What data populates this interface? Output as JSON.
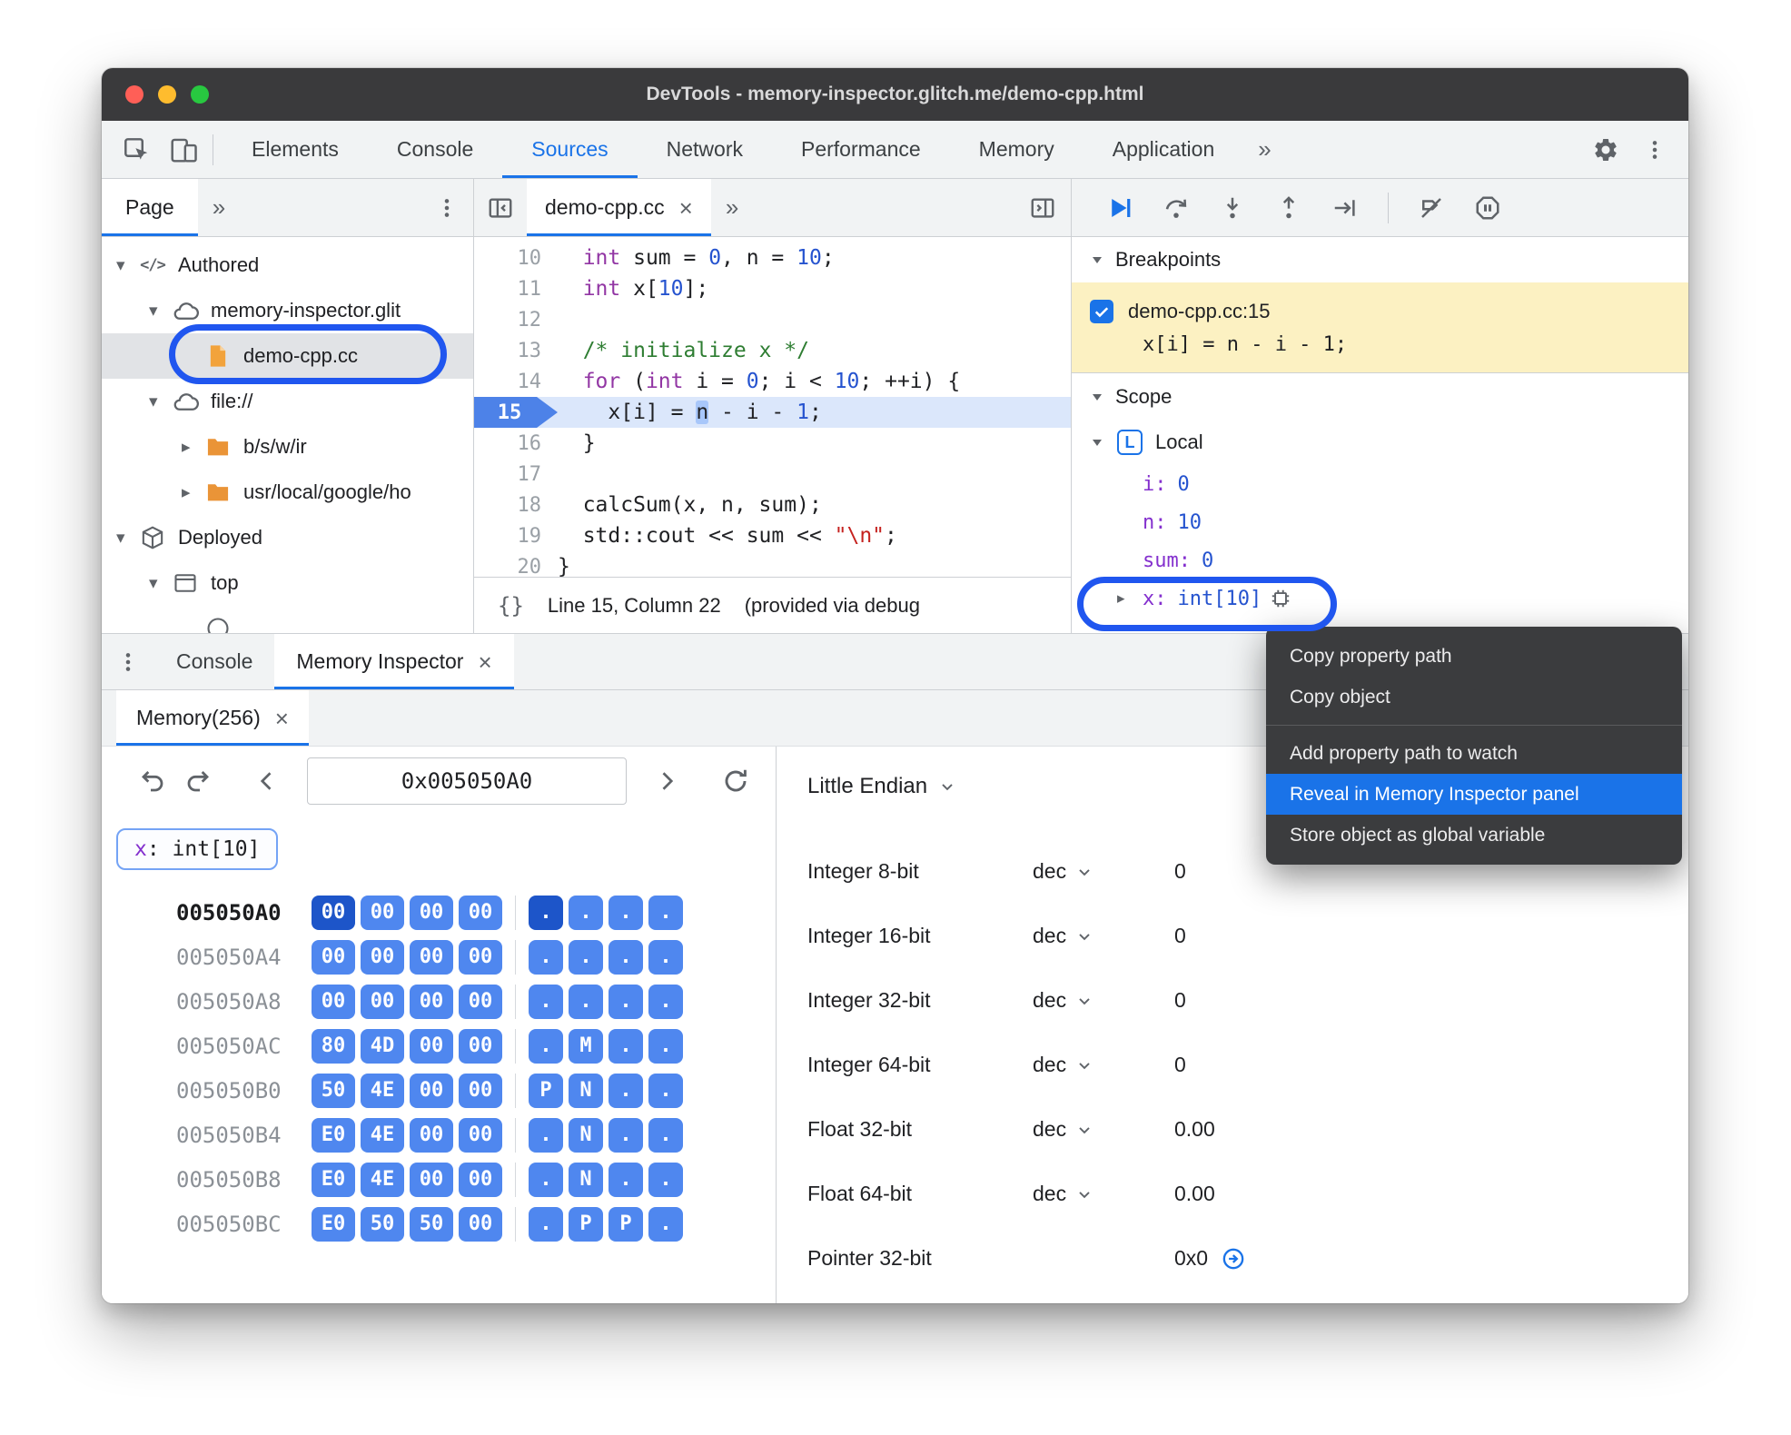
{
  "window": {
    "title": "DevTools - memory-inspector.glitch.me/demo-cpp.html"
  },
  "ui": {
    "close": "×",
    "braces": "{}"
  },
  "toolbar": {
    "tabs": [
      {
        "label": "Elements"
      },
      {
        "label": "Console"
      },
      {
        "label": "Sources",
        "active": true
      },
      {
        "label": "Network"
      },
      {
        "label": "Performance"
      },
      {
        "label": "Memory"
      },
      {
        "label": "Application"
      }
    ],
    "overflow": "»"
  },
  "page_panel": {
    "tab": "Page",
    "overflow": "»",
    "tree": [
      {
        "label": "Authored",
        "icon": "code",
        "depth": 0,
        "expander": "down"
      },
      {
        "label": "memory-inspector.glit",
        "icon": "cloud",
        "depth": 1,
        "expander": "down"
      },
      {
        "label": "demo-cpp.cc",
        "icon": "file",
        "depth": 2,
        "selected": true
      },
      {
        "label": "file://",
        "icon": "cloud",
        "depth": 1,
        "expander": "down"
      },
      {
        "label": "b/s/w/ir",
        "icon": "folder",
        "depth": 2,
        "expander": "right"
      },
      {
        "label": "usr/local/google/ho",
        "icon": "folder",
        "depth": 2,
        "expander": "right"
      },
      {
        "label": "Deployed",
        "icon": "package",
        "depth": 0,
        "expander": "down"
      },
      {
        "label": "top",
        "icon": "frame",
        "depth": 1,
        "expander": "down"
      },
      {
        "label": "",
        "icon": "globe",
        "depth": 2
      }
    ]
  },
  "editor": {
    "tab": "demo-cpp.cc",
    "overflow": "»",
    "first_line": 10,
    "current_line": 15,
    "lines": [
      [
        {
          "t": "  "
        },
        {
          "t": "int",
          "c": "kw"
        },
        {
          "t": " sum = "
        },
        {
          "t": "0",
          "c": "num"
        },
        {
          "t": ", n = "
        },
        {
          "t": "10",
          "c": "num"
        },
        {
          "t": ";"
        }
      ],
      [
        {
          "t": "  "
        },
        {
          "t": "int",
          "c": "kw"
        },
        {
          "t": " x["
        },
        {
          "t": "10",
          "c": "num"
        },
        {
          "t": "];"
        }
      ],
      [],
      [
        {
          "t": "  "
        },
        {
          "t": "/* initialize x */",
          "c": "com"
        }
      ],
      [
        {
          "t": "  "
        },
        {
          "t": "for",
          "c": "kw"
        },
        {
          "t": " ("
        },
        {
          "t": "int",
          "c": "kw"
        },
        {
          "t": " i = "
        },
        {
          "t": "0",
          "c": "num"
        },
        {
          "t": "; i < "
        },
        {
          "t": "10",
          "c": "num"
        },
        {
          "t": "; ++i) {"
        }
      ],
      [
        {
          "t": "    x[i] = "
        },
        {
          "t": "n",
          "c": "hl"
        },
        {
          "t": " - i - "
        },
        {
          "t": "1",
          "c": "num"
        },
        {
          "t": ";"
        }
      ],
      [
        {
          "t": "  }"
        }
      ],
      [],
      [
        {
          "t": "  calcSum(x, n, sum);"
        }
      ],
      [
        {
          "t": "  std::cout << sum << "
        },
        {
          "t": "\"\\n\"",
          "c": "str"
        },
        {
          "t": ";"
        }
      ],
      [
        {
          "t": "}"
        }
      ]
    ],
    "status": {
      "line_col": "Line 15, Column 22",
      "note": "(provided via debug"
    }
  },
  "debugger": {
    "breakpoints_title": "Breakpoints",
    "breakpoint": {
      "checked": true,
      "label": "demo-cpp.cc:15",
      "code": "x[i] = n - i - 1;"
    },
    "scope_title": "Scope",
    "scope_section": "Local",
    "local_badge": "L",
    "vars": [
      {
        "name": "i",
        "value": "0"
      },
      {
        "name": "n",
        "value": "10"
      },
      {
        "name": "sum",
        "value": "0"
      },
      {
        "name": "x",
        "value": "int[10]",
        "expandable": true,
        "memicon": true
      }
    ]
  },
  "context_menu": {
    "items": [
      {
        "label": "Copy property path"
      },
      {
        "label": "Copy object"
      },
      {
        "sep": true
      },
      {
        "label": "Add property path to watch"
      },
      {
        "label": "Reveal in Memory Inspector panel",
        "highlight": true
      },
      {
        "label": "Store object as global variable"
      }
    ]
  },
  "drawer": {
    "tabs": [
      {
        "label": "Console"
      },
      {
        "label": "Memory Inspector",
        "active": true,
        "closable": true
      }
    ]
  },
  "memory": {
    "panel_tab": "Memory(256)",
    "address": "0x005050A0",
    "tag_name": "x",
    "tag_type": ": int[10]",
    "endianness": "Little Endian",
    "rows": [
      {
        "addr": "005050A0",
        "strong": true,
        "selected": 0,
        "bytes": [
          "00",
          "00",
          "00",
          "00"
        ],
        "ascii": [
          ".",
          ".",
          ".",
          "."
        ]
      },
      {
        "addr": "005050A4",
        "bytes": [
          "00",
          "00",
          "00",
          "00"
        ],
        "ascii": [
          ".",
          ".",
          ".",
          "."
        ]
      },
      {
        "addr": "005050A8",
        "bytes": [
          "00",
          "00",
          "00",
          "00"
        ],
        "ascii": [
          ".",
          ".",
          ".",
          "."
        ]
      },
      {
        "addr": "005050AC",
        "bytes": [
          "80",
          "4D",
          "00",
          "00"
        ],
        "ascii": [
          ".",
          "M",
          ".",
          "."
        ]
      },
      {
        "addr": "005050B0",
        "bytes": [
          "50",
          "4E",
          "00",
          "00"
        ],
        "ascii": [
          "P",
          "N",
          ".",
          "."
        ]
      },
      {
        "addr": "005050B4",
        "bytes": [
          "E0",
          "4E",
          "00",
          "00"
        ],
        "ascii": [
          ".",
          "N",
          ".",
          "."
        ]
      },
      {
        "addr": "005050B8",
        "bytes": [
          "E0",
          "4E",
          "00",
          "00"
        ],
        "ascii": [
          ".",
          "N",
          ".",
          "."
        ]
      },
      {
        "addr": "005050BC",
        "bytes": [
          "E0",
          "50",
          "50",
          "00"
        ],
        "ascii": [
          ".",
          "P",
          "P",
          "."
        ]
      }
    ],
    "value_rows": [
      {
        "label": "Integer 8-bit",
        "fmt": "dec",
        "value": "0"
      },
      {
        "label": "Integer 16-bit",
        "fmt": "dec",
        "value": "0"
      },
      {
        "label": "Integer 32-bit",
        "fmt": "dec",
        "value": "0"
      },
      {
        "label": "Integer 64-bit",
        "fmt": "dec",
        "value": "0"
      },
      {
        "label": "Float 32-bit",
        "fmt": "dec",
        "value": "0.00"
      },
      {
        "label": "Float 64-bit",
        "fmt": "dec",
        "value": "0.00"
      },
      {
        "label": "Pointer 32-bit",
        "value": "0x0",
        "jump": true
      }
    ]
  },
  "colors": {
    "accent": "#1a73e8",
    "chip": "#4f87ef",
    "chip_selected": "#1d55c9",
    "breakpoint_bg": "#fcf1c2",
    "annotation": "#2056ef",
    "menu_bg": "#3b3c3e"
  }
}
